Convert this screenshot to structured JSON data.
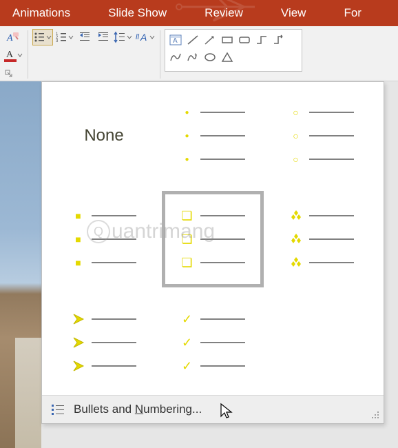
{
  "ribbon": {
    "tabs": [
      "Animations",
      "Slide Show",
      "Review",
      "View",
      "For"
    ]
  },
  "toolbar": {
    "icons": {
      "clear_format": "clear-formatting",
      "bullets": "bullets",
      "numbering": "numbering",
      "decrease_indent": "decrease-indent",
      "increase_indent": "increase-indent",
      "line_spacing": "line-spacing",
      "text_direction": "text-direction",
      "text_align_box": "align-text-box",
      "font_color": "font-color",
      "text_box": "text-box"
    }
  },
  "bullets_dropdown": {
    "none_label": "None",
    "options": [
      {
        "id": "none",
        "type": "none"
      },
      {
        "id": "small-dot",
        "type": "dot-small"
      },
      {
        "id": "open-circle",
        "type": "circle-open"
      },
      {
        "id": "filled-square",
        "type": "square-filled"
      },
      {
        "id": "open-square",
        "type": "square-open",
        "selected": true
      },
      {
        "id": "four-diamond",
        "type": "diamond-cluster"
      },
      {
        "id": "arrowhead",
        "type": "arrowhead"
      },
      {
        "id": "checkmark",
        "type": "check"
      }
    ],
    "footer_label_pre": "Bullets and ",
    "footer_mnemonic": "N",
    "footer_label_post": "umbering..."
  },
  "watermark": {
    "text_pre": "uantrimang"
  },
  "colors": {
    "ribbon": "#b83b1d",
    "bullet_glyph": "#e4d900",
    "line": "#808080",
    "font_color_swatch": "#c62828"
  }
}
